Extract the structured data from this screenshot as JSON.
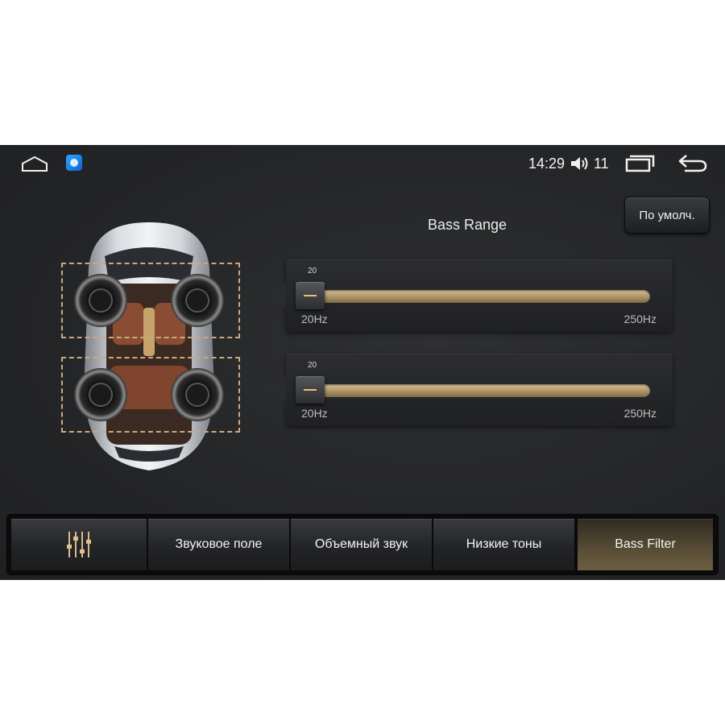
{
  "statusbar": {
    "time": "14:29",
    "volume_level": "11",
    "icons": [
      "home-icon",
      "app-icon",
      "volume-icon",
      "recents-icon",
      "back-icon"
    ]
  },
  "default_button": {
    "label": "По умолч."
  },
  "section": {
    "title": "Bass Range"
  },
  "sliders": [
    {
      "value_label": "20",
      "min_label": "20Hz",
      "max_label": "250Hz",
      "value": 20,
      "min": 20,
      "max": 250
    },
    {
      "value_label": "20",
      "min_label": "20Hz",
      "max_label": "250Hz",
      "value": 20,
      "min": 20,
      "max": 250
    }
  ],
  "tabs": [
    {
      "label": "",
      "icon": "equalizer-icon",
      "active": false
    },
    {
      "label": "Звуковое поле",
      "active": false
    },
    {
      "label": "Объемный звук",
      "active": false
    },
    {
      "label": "Низкие тоны",
      "active": false
    },
    {
      "label": "Bass Filter",
      "active": true
    }
  ],
  "colors": {
    "accent_gold": "#c9aa80",
    "slider_gold": "#d9c39b",
    "active_tab": "#5b4f36"
  }
}
